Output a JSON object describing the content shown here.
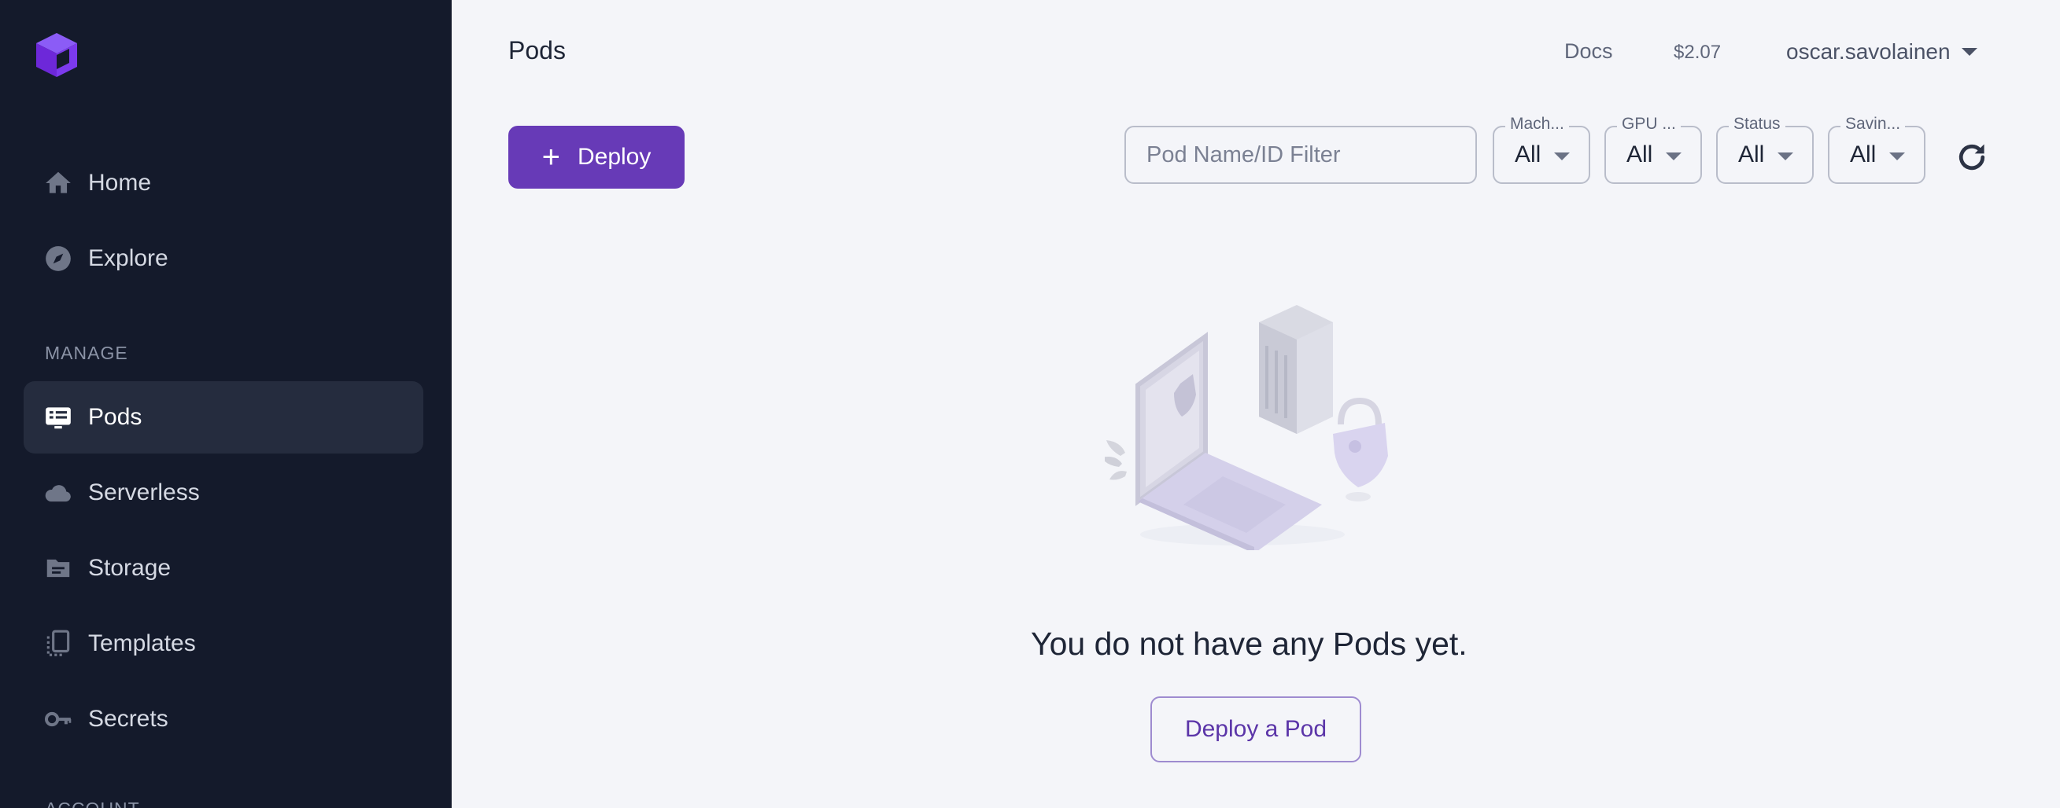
{
  "sidebar": {
    "items": [
      {
        "label": "Home",
        "icon": "home-icon"
      },
      {
        "label": "Explore",
        "icon": "compass-icon"
      },
      {
        "label": "Pods",
        "icon": "pods-icon",
        "active": true
      },
      {
        "label": "Serverless",
        "icon": "cloud-icon"
      },
      {
        "label": "Storage",
        "icon": "folder-icon"
      },
      {
        "label": "Templates",
        "icon": "templates-icon"
      },
      {
        "label": "Secrets",
        "icon": "key-icon"
      }
    ],
    "sections": {
      "manage": "MANAGE",
      "account": "ACCOUNT"
    }
  },
  "header": {
    "title": "Pods",
    "docs": "Docs",
    "balance": "$2.07",
    "user": "oscar.savolainen"
  },
  "toolbar": {
    "deploy_label": "Deploy",
    "filter_placeholder": "Pod Name/ID Filter",
    "selects": [
      {
        "label": "Mach...",
        "value": "All"
      },
      {
        "label": "GPU ...",
        "value": "All"
      },
      {
        "label": "Status",
        "value": "All"
      },
      {
        "label": "Savin...",
        "value": "All"
      }
    ]
  },
  "empty_state": {
    "message": "You do not have any Pods yet.",
    "button": "Deploy a Pod"
  },
  "colors": {
    "accent": "#673ab7",
    "sidebar_bg": "#141a2b",
    "page_bg": "#f4f5f9"
  }
}
